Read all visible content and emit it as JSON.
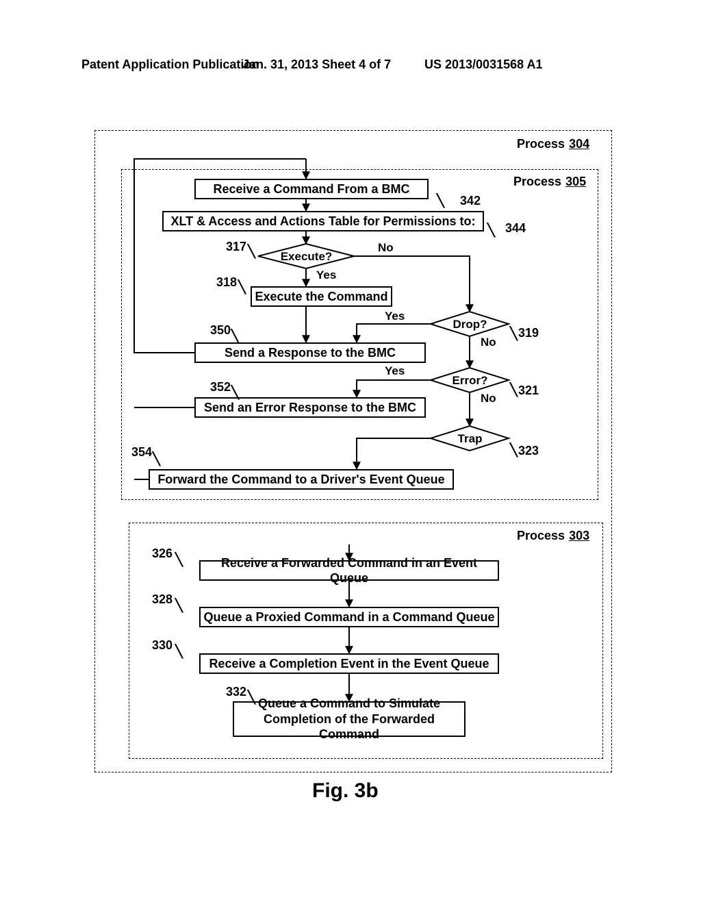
{
  "header": {
    "left": "Patent Application Publication",
    "center": "Jan. 31, 2013  Sheet 4 of 7",
    "right": "US 2013/0031568 A1"
  },
  "procLabels": {
    "p304": {
      "text": "Process",
      "num": "304"
    },
    "p305": {
      "text": "Process",
      "num": "305"
    },
    "p303": {
      "text": "Process",
      "num": "303"
    }
  },
  "steps": {
    "s342": "Receive a Command From a BMC",
    "s344": "XLT & Access and Actions Table for Permissions to:",
    "s318": "Execute the Command",
    "s350": "Send a Response to the BMC",
    "s352": "Send an Error Response to the BMC",
    "s354": "Forward the Command to a Driver's Event Queue",
    "s326": "Receive a Forwarded Command in an Event Queue",
    "s328": "Queue a Proxied Command in a Command Queue",
    "s330": "Receive a Completion Event in the Event Queue",
    "s332": "Queue a Command to Simulate\nCompletion of the Forwarded Command"
  },
  "decisions": {
    "d317": "Execute?",
    "d319": "Drop?",
    "d321": "Error?",
    "d323": "Trap"
  },
  "branches": {
    "yes": "Yes",
    "no": "No"
  },
  "refs": {
    "r342": "342",
    "r344": "344",
    "r317": "317",
    "r318": "318",
    "r319": "319",
    "r350": "350",
    "r321": "321",
    "r352": "352",
    "r323": "323",
    "r354": "354",
    "r326": "326",
    "r328": "328",
    "r330": "330",
    "r332": "332"
  },
  "figure": "Fig. 3b"
}
